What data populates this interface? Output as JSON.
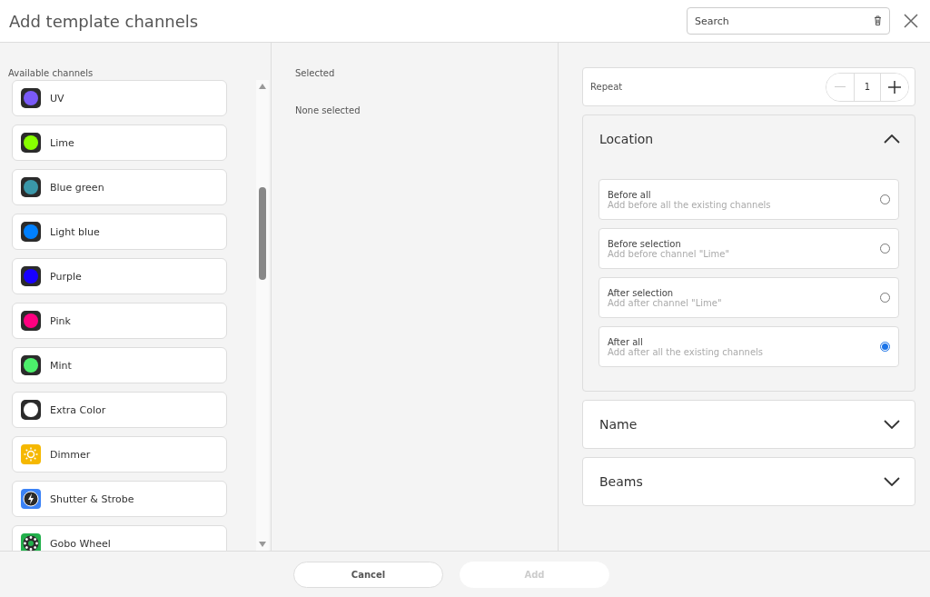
{
  "window": {
    "title": "Add template channels"
  },
  "search": {
    "placeholder": "Search"
  },
  "available": {
    "label": "Available channels",
    "channels": [
      {
        "name": "UV",
        "kind": "color",
        "color": "#7a5af8"
      },
      {
        "name": "Lime",
        "kind": "color",
        "color": "#88ff00"
      },
      {
        "name": "Blue green",
        "kind": "color",
        "color": "#3a97a9"
      },
      {
        "name": "Light blue",
        "kind": "color",
        "color": "#0080ff"
      },
      {
        "name": "Purple",
        "kind": "color",
        "color": "#1800ff"
      },
      {
        "name": "Pink",
        "kind": "color",
        "color": "#ff0080"
      },
      {
        "name": "Mint",
        "kind": "color",
        "color": "#4cf06b"
      },
      {
        "name": "Extra Color",
        "kind": "color",
        "color": "#ffffff"
      },
      {
        "name": "Dimmer",
        "kind": "dimmer"
      },
      {
        "name": "Shutter & Strobe",
        "kind": "shutter"
      },
      {
        "name": "Gobo Wheel",
        "kind": "gobo"
      }
    ]
  },
  "selected": {
    "label": "Selected",
    "empty_text": "None selected"
  },
  "repeat": {
    "label": "Repeat",
    "value": "1"
  },
  "sections": [
    {
      "title": "Location",
      "expanded": true,
      "options": [
        {
          "title": "Before all",
          "description": "Add before all the existing channels",
          "selected": false
        },
        {
          "title": "Before selection",
          "description": "Add before channel \"Lime\"",
          "selected": false
        },
        {
          "title": "After selection",
          "description": "Add after channel \"Lime\"",
          "selected": false
        },
        {
          "title": "After all",
          "description": "Add after all the existing channels",
          "selected": true
        }
      ]
    },
    {
      "title": "Name",
      "expanded": false
    },
    {
      "title": "Beams",
      "expanded": false
    }
  ],
  "buttons": [
    {
      "label": "Cancel",
      "disabled": false
    },
    {
      "label": "Add",
      "disabled": true
    }
  ]
}
